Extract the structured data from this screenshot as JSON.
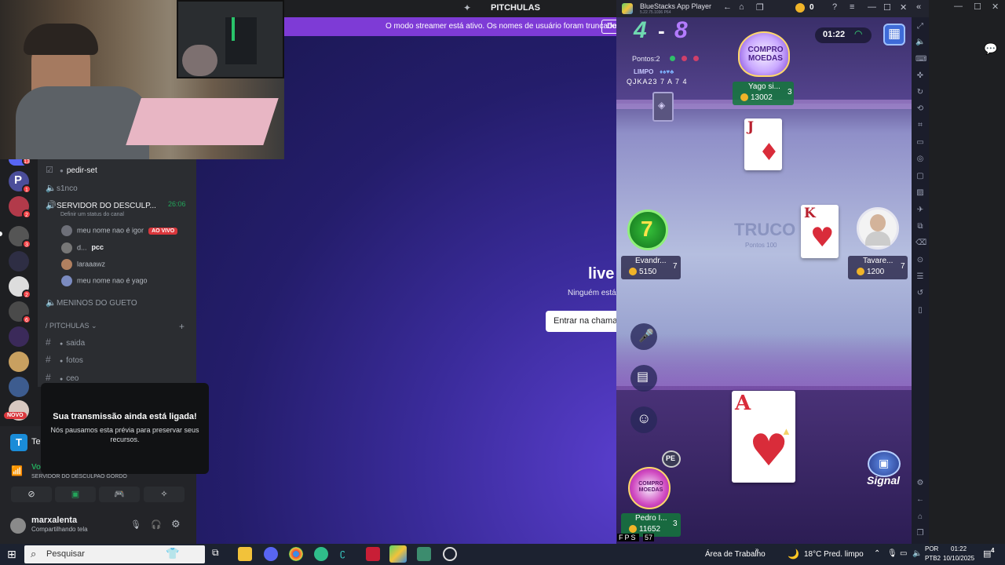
{
  "discord": {
    "window_title": "PITCHULAS",
    "notice_text": "O modo streamer está ativo. Os nomes de usuário foram truncados.",
    "notice_button": "De",
    "stage_title": "live",
    "stage_sub": "Ninguém está e",
    "join_button": "Entrar na chama",
    "server_badges": [
      "13",
      "1",
      "2",
      "3",
      "2",
      "6"
    ],
    "new_label": "NOVO",
    "channels": [
      {
        "name": "pedir-set"
      },
      {
        "name": "s1nco"
      },
      {
        "name": "SERVIDOR DO DESCULP...",
        "time": "26:06",
        "status": "Definir um status do canal"
      },
      {
        "name": "MENINOS DO GUETO"
      },
      {
        "category": "/ PITCHULAS"
      },
      {
        "name": "saida"
      },
      {
        "name": "fotos"
      },
      {
        "name": "ceo"
      }
    ],
    "voice_users": [
      {
        "name": "meu nome nao é igor",
        "badge": "AO VIVO"
      },
      {
        "name": "d...",
        "tag": "pcc"
      },
      {
        "name": "laraaawz"
      },
      {
        "name": "meu nome nao é yago"
      }
    ],
    "popup_title": "Sua transmissão ainda está ligada!",
    "popup_text": "Nós pausamos esta prévia para preservar seus recursos.",
    "app_label": "Tel",
    "voice_label": "Vo:",
    "voice_server": "SERVIDOR DO DESCULPAO GORDO",
    "username": "marxalenta",
    "user_status": "Compartilhando tela"
  },
  "bluestacks": {
    "title": "BlueStacks App Player",
    "version": "5.22.75.1036 P64",
    "coin_count": "0"
  },
  "game": {
    "score_left": "4",
    "score_sep": "-",
    "score_right": "8",
    "timer": "01:22",
    "points": "Pontos:2",
    "clean_label": "LIMPO",
    "sequence": "QJKA23 7 A 7 4",
    "banner": "COMPRO MOEDAS",
    "table_name": "TRUCO",
    "table_points": "Pontos 100",
    "turn_counter": "7",
    "signal_label": "Signal",
    "pe_label": "PE",
    "fps_label": "FPS",
    "fps_value": "57",
    "players": {
      "top": {
        "name": "Yago si...",
        "coins": "13002",
        "cards": "3"
      },
      "left": {
        "name": "Evandr...",
        "coins": "5150",
        "cards": "7"
      },
      "right": {
        "name": "Tavare...",
        "coins": "1200",
        "cards": "7"
      },
      "bottom": {
        "name": "Pedro I...",
        "coins": "11652",
        "cards": "3"
      }
    },
    "cards_on_table": [
      {
        "rank": "J",
        "suit": "♦"
      },
      {
        "rank": "K",
        "suit": "♥"
      },
      {
        "rank": "A",
        "suit": "♥"
      }
    ]
  },
  "taskbar": {
    "search_placeholder": "Pesquisar",
    "desktop_label": "Área de Trabalho",
    "weather": "18°C  Pred. limpo",
    "lang_top": "POR",
    "lang_bottom": "PTB2",
    "time": "01:22",
    "date": "10/10/2025",
    "notif_count": "4"
  }
}
